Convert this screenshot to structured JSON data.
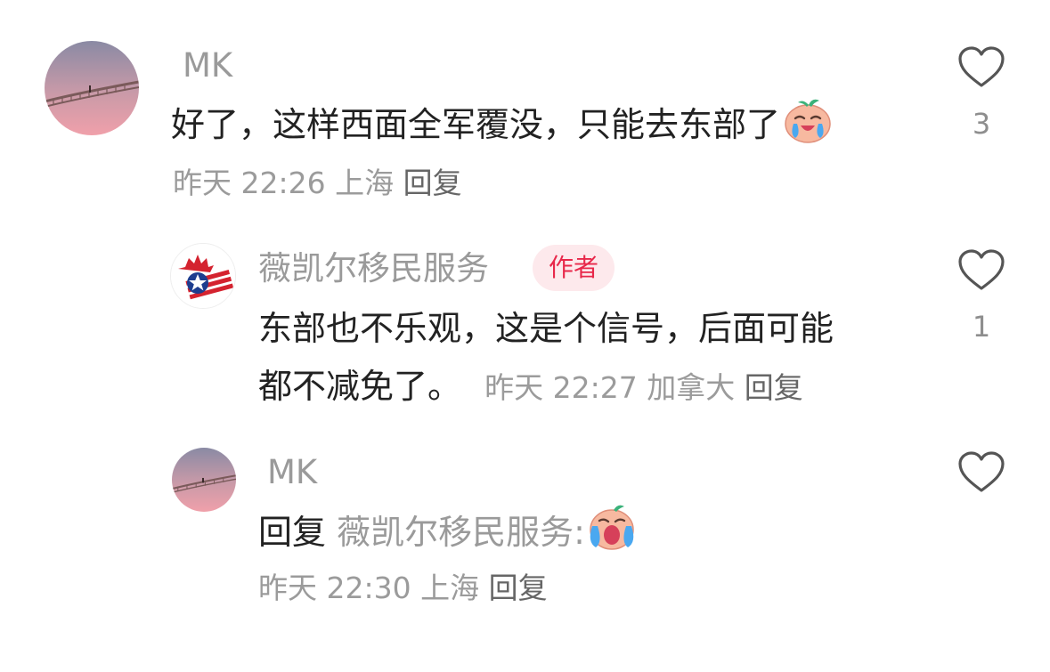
{
  "comments": [
    {
      "author": "MK",
      "text": "好了，这样西面全军覆没，只能去东部了",
      "time": "昨天 22:26",
      "location": "上海",
      "reply_label": "回复",
      "like_count": "3",
      "avatar_icon": "sunset-rope-bridge-avatar",
      "emoji_icon": "crying-emoji"
    },
    {
      "author": "薇凯尔移民服务",
      "author_badge": "作者",
      "text_line1": "东部也不乐观，这是个信号，后面可能",
      "text_line2": "都不减免了。",
      "time": "昨天 22:27",
      "location": "加拿大",
      "reply_label": "回复",
      "like_count": "1",
      "avatar_icon": "canada-usa-flag-avatar"
    },
    {
      "author": "MK",
      "reply_prefix": "回复",
      "reply_to": "薇凯尔移民服务:",
      "time": "昨天 22:30",
      "location": "上海",
      "reply_label": "回复",
      "like_count": "",
      "avatar_icon": "sunset-rope-bridge-avatar",
      "emoji_icon": "wailing-emoji"
    }
  ],
  "colors": {
    "author_gray": "#9a9a9a",
    "badge_bg": "#fde9ec",
    "badge_text": "#e8284a",
    "meta_gray": "#9b9b9b"
  }
}
